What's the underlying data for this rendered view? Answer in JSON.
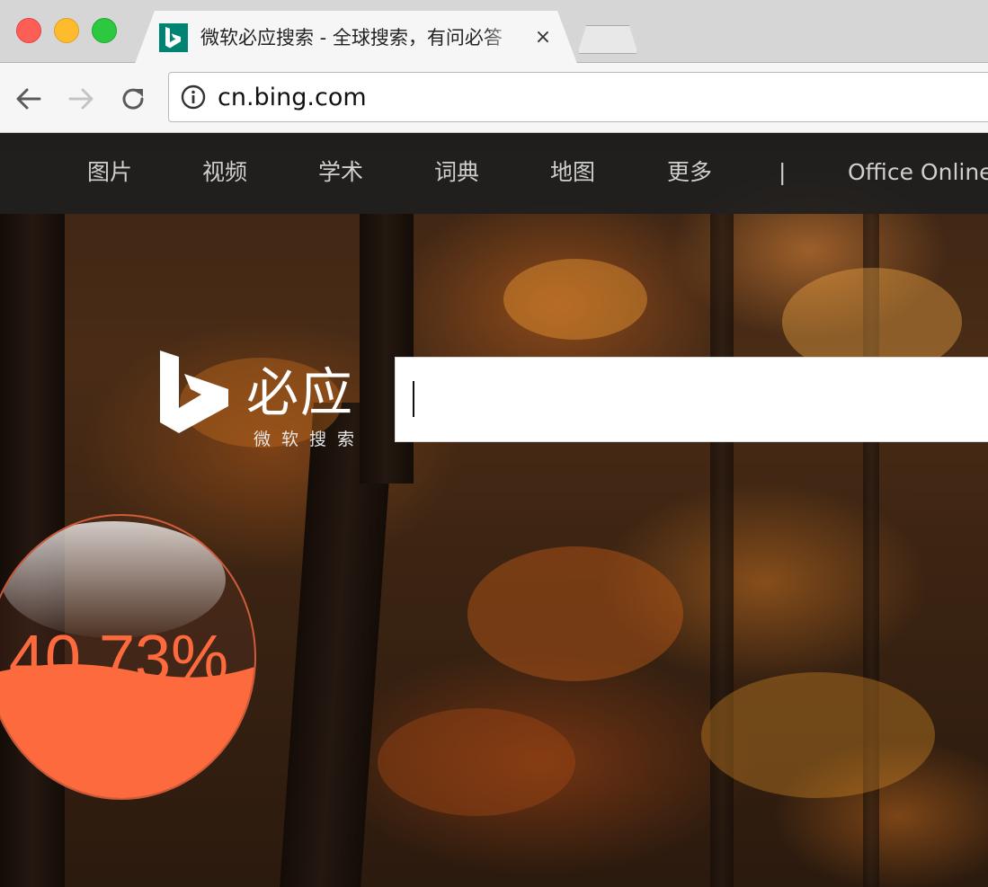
{
  "browser": {
    "tab": {
      "title": "微软必应搜索 - 全球搜索，有问必答",
      "close_glyph": "×"
    },
    "url": "cn.bing.com"
  },
  "nav": {
    "items": [
      "图片",
      "视频",
      "学术",
      "词典",
      "地图",
      "更多",
      "|",
      "Office Online"
    ]
  },
  "logo": {
    "name": "必应",
    "subtitle": "微软搜索"
  },
  "search": {
    "value": "",
    "placeholder": ""
  },
  "progress": {
    "value": 40.73,
    "label": "40.73%"
  },
  "colors": {
    "bing_teal": "#008373",
    "orb_orange": "#fd6a3e",
    "navbar_bg": "#1e1e1e"
  }
}
